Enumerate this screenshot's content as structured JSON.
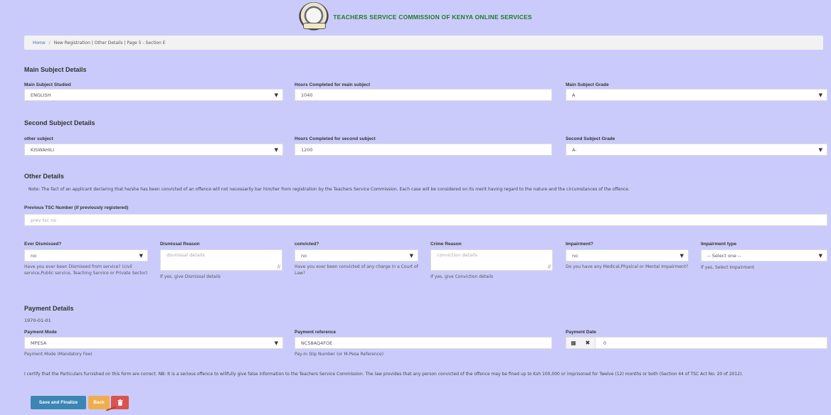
{
  "header": {
    "title": "TEACHERS SERVICE COMMISSION OF KENYA ONLINE SERVICES"
  },
  "breadcrumb": {
    "home": "Home",
    "separator": "/",
    "current": "New Registration | Other Details | Page 5 - Section E"
  },
  "main_subject": {
    "heading": "Main Subject Details",
    "studied_label": "Main Subject Studied",
    "studied_value": "ENGLISH",
    "hours_label": "Hours Completed for main subject",
    "hours_value": "1040",
    "grade_label": "Main Subject Grade",
    "grade_value": "A"
  },
  "second_subject": {
    "heading": "Second Subject Details",
    "other_label": "other subject",
    "other_value": "KISWAHILI",
    "hours_label": "Hours Completed for second subject",
    "hours_value": "1200",
    "grade_label": "Second Subject Grade",
    "grade_value": "A-"
  },
  "other_details": {
    "heading": "Other Details",
    "note": "Note: The fact of an applicant declaring that he/she has been convicted of an offence will not necessarily bar him/her from registration by the Teachers Service Commission. Each case will be considered on its merit having regard to the nature and the circumstances of the offence.",
    "prev_tsc_label": "Previous TSC Number (if previously registered)",
    "prev_tsc_placeholder": "prev tsc no",
    "dismissed_label": "Ever Dismissed?",
    "dismissed_value": "no",
    "dismissed_help": "Have you ever been Dismissed from service? (civil service,Public service, Teaching Service or Private Sector)",
    "dismissal_reason_label": "Dismissal Reason",
    "dismissal_reason_placeholder": "dismissal details",
    "dismissal_reason_help": "If yes, give Dismissal details",
    "convicted_label": "convicted?",
    "convicted_value": "no",
    "convicted_help": "Have you ever been convicted of any charge in a Court of Law?",
    "crime_reason_label": "Crime Reason",
    "crime_reason_placeholder": "conviction details",
    "crime_reason_help": "If yes, give Conviction details",
    "impairment_label": "Impairment?",
    "impairment_value": "no",
    "impairment_help": "Do you have any Medical,Physical or Mental Impairment?",
    "impairment_type_label": "Impairment type",
    "impairment_type_value": "-- Select one --",
    "impairment_type_help": "If yes, Select Impairment"
  },
  "payment": {
    "heading": "Payment Details",
    "date_text": "1970-01-01",
    "mode_label": "Payment Mode",
    "mode_value": "MPESA",
    "mode_help": "Payment Mode (Mandatory Fee)",
    "reference_label": "Payment reference",
    "reference_value": "NCS8AQ4FOE",
    "reference_help": "Pay-In Slip Number (or M-Pesa Reference)",
    "date_label": "Payment Date",
    "date_value": "0"
  },
  "certification": "I certify that the Particulars furnished on this form are correct. NB: It is a serious offence to willfully give false information to the Teachers Service Commission. The law provides that any person convicted of the offence may be fined up to Ksh 100,000 or imprisoned for Twelve (12) months or both (Section 44 of TSC Act No. 20 of 2012).",
  "buttons": {
    "save": "Save and Finalize",
    "back": "Back",
    "delete_icon": "trash-icon"
  },
  "icons": {
    "select_arrow": "▼",
    "calendar": "calendar-icon",
    "clear": "clear-icon",
    "resize": "//"
  },
  "colors": {
    "background": "#cbcbfb",
    "title_green": "#1f7a2b",
    "save_blue": "#3c86b4",
    "back_orange": "#f0ad4e",
    "delete_red": "#d9534f",
    "link_blue": "#3b6fb6"
  }
}
